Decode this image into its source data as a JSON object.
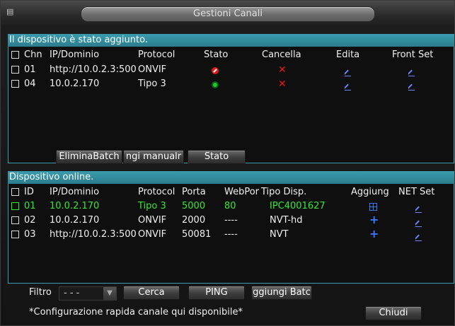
{
  "window": {
    "title": "Gestioni Canali"
  },
  "added_section": {
    "title": "Il dispositivo è stato aggiunto.",
    "headers": {
      "chn": "Chn",
      "ip": "IP/Dominio",
      "protocol": "Protocol",
      "stato": "Stato",
      "cancella": "Cancella",
      "edita": "Edita",
      "front_set": "Front Set"
    },
    "rows": [
      {
        "chn": "01",
        "ip": "http://10.0.2.3:500",
        "protocol": "ONVIF",
        "stato_icon": "disconnected-icon",
        "checked": false
      },
      {
        "chn": "04",
        "ip": "10.0.2.170",
        "protocol": "Tipo 3",
        "stato_icon": "connected-icon",
        "checked": false
      }
    ],
    "buttons": {
      "batch_delete": "EliminaBatch",
      "manual_add": "ngi manualr",
      "stato": "Stato"
    }
  },
  "online_section": {
    "title": "Dispositivo online.",
    "headers": {
      "id": "ID",
      "ip": "IP/Dominio",
      "protocol": "Protocol",
      "porta": "Porta",
      "webport": "WebPor",
      "tipo": "Tipo Disp.",
      "aggiungi": "Aggiung",
      "net_set": "NET Set"
    },
    "rows": [
      {
        "id": "01",
        "ip": "10.0.2.170",
        "protocol": "Tipo 3",
        "porta": "5000",
        "webport": "80",
        "tipo": "IPC4001627",
        "added": true,
        "highlight": true
      },
      {
        "id": "02",
        "ip": "10.0.2.170",
        "protocol": "ONVIF",
        "porta": "2000",
        "webport": "----",
        "tipo": "NVT-hd",
        "added": false,
        "highlight": false
      },
      {
        "id": "03",
        "ip": "http://10.0.2.3:500",
        "protocol": "ONVIF",
        "porta": "50081",
        "webport": "----",
        "tipo": "NVT",
        "added": false,
        "highlight": false
      }
    ]
  },
  "footer": {
    "filter_label": "Filtro",
    "filter_value": "- - -",
    "search": "Cerca",
    "ping": "PING",
    "batch_add": "ggiungi Batc",
    "hint": "*Configurazione rapida canale qui disponibile*",
    "close": "Chiudi"
  },
  "colors": {
    "section_bar": "#3a9cae",
    "highlight_row": "#34e834",
    "icon_blue": "#3a78ff",
    "icon_red": "#e81818"
  }
}
